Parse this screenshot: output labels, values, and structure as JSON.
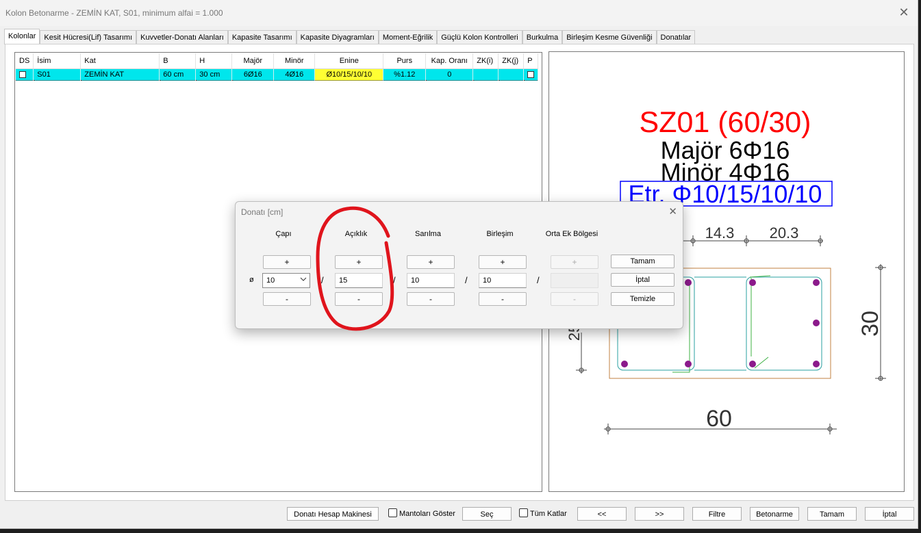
{
  "window": {
    "title": "Kolon Betonarme - ZEMİN KAT, S01, minimum alfai = 1.000",
    "close_glyph": "✕"
  },
  "tabs": [
    {
      "label": "Kolonlar",
      "active": true
    },
    {
      "label": "Kesit Hücresi(Lif) Tasarımı"
    },
    {
      "label": "Kuvvetler-Donatı Alanları"
    },
    {
      "label": "Kapasite Tasarımı"
    },
    {
      "label": "Kapasite Diyagramları"
    },
    {
      "label": "Moment-Eğrilik"
    },
    {
      "label": "Güçlü Kolon Kontrolleri"
    },
    {
      "label": "Burkulma"
    },
    {
      "label": "Birleşim Kesme Güvenliği"
    },
    {
      "label": "Donatılar"
    }
  ],
  "grid": {
    "headers": [
      "DS",
      "İsim",
      "Kat",
      "B",
      "H",
      "Majör",
      "Minör",
      "Enine",
      "Purs",
      "Kap. Oranı",
      "ZK(i)",
      "ZK(j)",
      "P"
    ],
    "row": {
      "ds": "",
      "isim": "S01",
      "kat": "ZEMİN KAT",
      "b": "60 cm",
      "h": "30 cm",
      "major": "6Ø16",
      "minor": "4Ø16",
      "enine": "Ø10/15/10/10",
      "purs": "%1.12",
      "kap": "0",
      "zki": "",
      "zkj": "",
      "p": ""
    }
  },
  "preview": {
    "title": "SZ01 (60/30)",
    "major": "Majör 6Φ16",
    "minor": "Minör 4Φ16",
    "etr": "Etr. Φ10/15/10/10",
    "dim_top1": "14.3",
    "dim_top2": "20.3",
    "dim_left": "25",
    "dim_right": "30",
    "dim_bottom": "60",
    "colors": {
      "title": "#ff0000",
      "etr": "#0000ff",
      "bars": "#8b1a8b",
      "stirrup": "#2aa0a0",
      "outline": "#c08040"
    }
  },
  "dialog": {
    "title": "Donatı  [cm]",
    "close_glyph": "✕",
    "columns": [
      {
        "header": "Çapı",
        "value": "10",
        "type": "select",
        "enabled": true
      },
      {
        "header": "Açıklık",
        "value": "15",
        "type": "input",
        "enabled": true
      },
      {
        "header": "Sarılma",
        "value": "10",
        "type": "input",
        "enabled": true
      },
      {
        "header": "Birleşim",
        "value": "10",
        "type": "input",
        "enabled": true
      },
      {
        "header": "Orta Ek Bölgesi",
        "value": "",
        "type": "input",
        "enabled": false
      }
    ],
    "diameter_symbol": "ø",
    "plus": "+",
    "minus": "-",
    "slash": "/",
    "buttons": {
      "ok": "Tamam",
      "cancel": "İptal",
      "clear": "Temizle"
    },
    "annotation_color": "#e0141c"
  },
  "bottom": {
    "calc": "Donatı Hesap Makinesi",
    "mantolar": "Mantoları Göster",
    "sec": "Seç",
    "tum_katlar": "Tüm Katlar",
    "prev": "<<",
    "next": ">>",
    "filtre": "Filtre",
    "betonarme": "Betonarme",
    "tamam": "Tamam",
    "iptal": "İptal"
  }
}
